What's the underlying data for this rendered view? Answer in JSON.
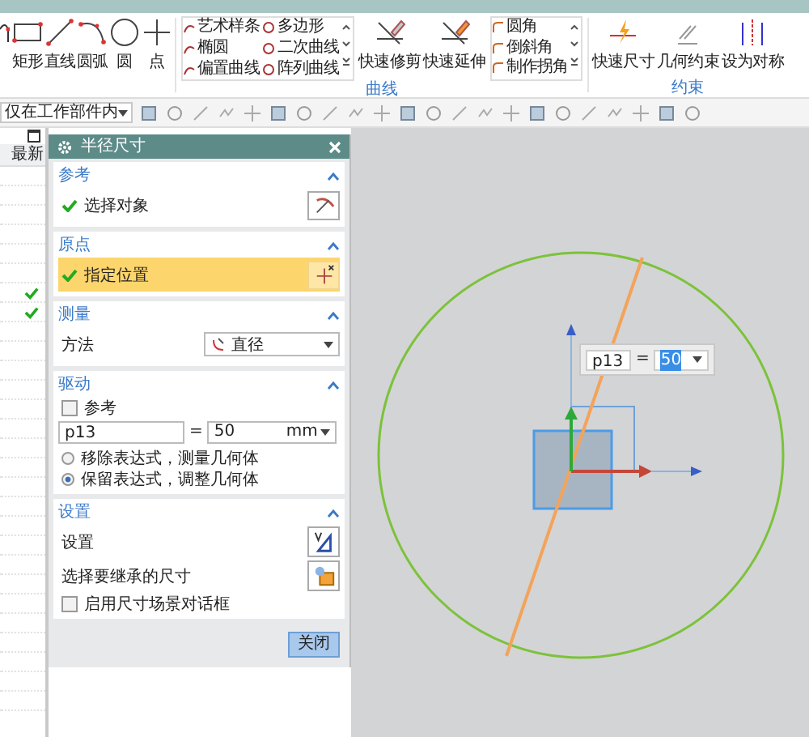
{
  "ribbon": {
    "sketch_tools": [
      {
        "label": "矩形"
      },
      {
        "label": "直线"
      },
      {
        "label": "圆弧"
      },
      {
        "label": "圆"
      },
      {
        "label": "点"
      }
    ],
    "curve_group": {
      "gallery": [
        {
          "label": "艺术样条"
        },
        {
          "label": "多边形"
        },
        {
          "label": "椭圆"
        },
        {
          "label": "二次曲线"
        },
        {
          "label": "偏置曲线"
        },
        {
          "label": "阵列曲线"
        }
      ],
      "edit_tools": [
        {
          "label": "快速修剪"
        },
        {
          "label": "快速延伸"
        }
      ],
      "corner_gallery": [
        {
          "label": "圆角"
        },
        {
          "label": "倒斜角"
        },
        {
          "label": "制作拐角"
        }
      ],
      "label": "曲线"
    },
    "constraint_group": {
      "tools": [
        {
          "label": "快速尺寸"
        },
        {
          "label": "几何约束"
        },
        {
          "label": "设为对称"
        }
      ],
      "label": "约束"
    }
  },
  "toolbar": {
    "filter": "仅在工作部件内"
  },
  "navigator": {
    "column_header": "最新",
    "rows": [
      {
        "checked": false
      },
      {
        "checked": false
      },
      {
        "checked": false
      },
      {
        "checked": false
      },
      {
        "checked": false
      },
      {
        "checked": false
      },
      {
        "checked": true
      },
      {
        "checked": true
      },
      {
        "checked": false
      },
      {
        "checked": false
      },
      {
        "checked": false
      },
      {
        "checked": false
      },
      {
        "checked": false
      },
      {
        "checked": false
      },
      {
        "checked": false
      },
      {
        "checked": false
      },
      {
        "checked": false
      },
      {
        "checked": false
      },
      {
        "checked": false
      },
      {
        "checked": false
      },
      {
        "checked": false
      },
      {
        "checked": false
      },
      {
        "checked": false
      },
      {
        "checked": false
      },
      {
        "checked": false
      },
      {
        "checked": false
      },
      {
        "checked": false
      },
      {
        "checked": false
      }
    ]
  },
  "dialog": {
    "title": "半径尺寸",
    "sections": [
      {
        "kind": "select",
        "title": "参考",
        "expanded": true,
        "label": "选择对象",
        "done": true,
        "active": false
      },
      {
        "kind": "select",
        "title": "原点",
        "expanded": true,
        "label": "指定位置",
        "done": true,
        "active": true
      },
      {
        "kind": "method",
        "title": "测量",
        "expanded": true,
        "label": "方法",
        "value": "直径"
      },
      {
        "kind": "drive",
        "title": "驱动",
        "expanded": true,
        "reference": {
          "label": "参考",
          "checked": false
        },
        "expression": "p13",
        "equals": "=",
        "value": "50",
        "unit": "mm",
        "options": [
          {
            "label": "移除表达式，测量几何体",
            "selected": false
          },
          {
            "label": "保留表达式，调整几何体",
            "selected": true
          }
        ]
      },
      {
        "kind": "settings",
        "title": "设置",
        "expanded": true,
        "rows": [
          {
            "label": "设置"
          },
          {
            "label": "选择要继承的尺寸"
          }
        ],
        "option": {
          "label": "启用尺寸场景对话框",
          "checked": false
        }
      }
    ],
    "close_button": "关闭"
  },
  "canvas": {
    "overlay": {
      "expression": "p13",
      "equals": "=",
      "value": "50",
      "value_selected": true
    }
  }
}
